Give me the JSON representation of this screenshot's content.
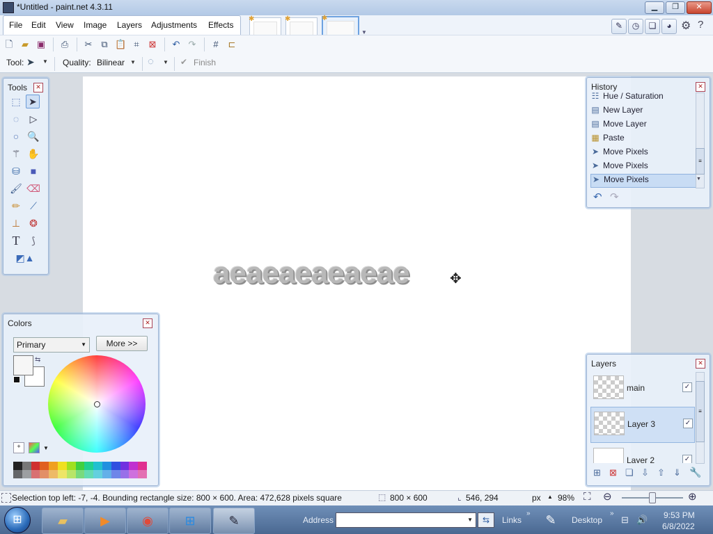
{
  "window": {
    "title": "*Untitled - paint.net 4.3.11"
  },
  "menu": [
    "File",
    "Edit",
    "View",
    "Image",
    "Layers",
    "Adjustments",
    "Effects"
  ],
  "toolbar": {
    "tool_label": "Tool:",
    "quality_label": "Quality:",
    "quality_value": "Bilinear",
    "finish_label": "Finish"
  },
  "canvas_text": "aeaeaeaeaeae",
  "tools_panel": {
    "title": "Tools"
  },
  "history_panel": {
    "title": "History",
    "items": [
      "Hue / Saturation",
      "New Layer",
      "Move Layer",
      "Paste",
      "Move Pixels",
      "Move Pixels",
      "Move Pixels"
    ],
    "selected_index": 6
  },
  "layers_panel": {
    "title": "Layers",
    "layers": [
      {
        "name": "main",
        "visible": true,
        "selected": false
      },
      {
        "name": "Layer 3",
        "visible": true,
        "selected": true
      },
      {
        "name": "Layer 2",
        "visible": true,
        "selected": false
      }
    ]
  },
  "colors_panel": {
    "title": "Colors",
    "mode": "Primary",
    "more_label": "More >>",
    "palette": [
      "#222222",
      "#777777",
      "#d03030",
      "#e06020",
      "#f0a020",
      "#f0e020",
      "#a0e020",
      "#40d040",
      "#20d090",
      "#20c0d0",
      "#2090e0",
      "#3050e0",
      "#7030e0",
      "#c030d0",
      "#e03090"
    ]
  },
  "status": {
    "selection": "Selection top left: -7, -4. Bounding rectangle size: 800 × 600. Area: 472,628 pixels square",
    "image_size": "800 × 600",
    "cursor_pos": "546, 294",
    "units": "px",
    "zoom": "98%"
  },
  "taskbar": {
    "address_label": "Address",
    "links_label": "Links",
    "desktop_label": "Desktop",
    "time": "9:53 PM",
    "date": "6/8/2022"
  }
}
